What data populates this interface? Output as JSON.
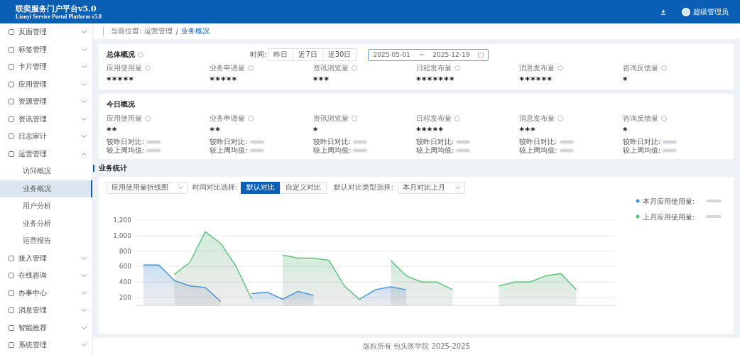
{
  "header": {
    "title": "联奕服务门户平台v5.0",
    "subtitle": "Lianyi Service Portal Platform v5.0",
    "user": "超级管理员"
  },
  "sidebar": {
    "items": [
      {
        "label": "页面管理",
        "expanded": false
      },
      {
        "label": "标签管理",
        "expanded": false
      },
      {
        "label": "卡片管理",
        "expanded": false
      },
      {
        "label": "应用管理",
        "expanded": false
      },
      {
        "label": "资源管理",
        "expanded": false
      },
      {
        "label": "资讯管理",
        "expanded": false
      },
      {
        "label": "日志审计",
        "expanded": false
      },
      {
        "label": "运营管理",
        "expanded": true,
        "children": [
          {
            "label": "访问概况",
            "selected": false
          },
          {
            "label": "业务概况",
            "selected": true
          },
          {
            "label": "用户分析",
            "selected": false
          },
          {
            "label": "业务分析",
            "selected": false
          },
          {
            "label": "运营报告",
            "selected": false
          }
        ]
      },
      {
        "label": "接入管理",
        "expanded": false
      },
      {
        "label": "在线咨询",
        "expanded": false
      },
      {
        "label": "办事中心",
        "expanded": false
      },
      {
        "label": "消息管理",
        "expanded": false
      },
      {
        "label": "智能推荐",
        "expanded": false
      },
      {
        "label": "系统管理",
        "expanded": false
      }
    ]
  },
  "breadcrumb": {
    "prefix": "当前位置:",
    "items": [
      "运营管理",
      "业务概况"
    ],
    "separator": "/"
  },
  "overall": {
    "title": "总体概况",
    "time_label": "时间:",
    "time_buttons": [
      {
        "label": "昨日",
        "selected": false
      },
      {
        "label": "近7日",
        "selected": false
      },
      {
        "label": "近30日",
        "selected": false
      }
    ],
    "date_start": "2025-05-01",
    "date_sep": "~",
    "date_end": "2025-12-19",
    "metrics": [
      {
        "label": "应用使用量",
        "value": "*****"
      },
      {
        "label": "业务申请量",
        "value": "*****"
      },
      {
        "label": "资讯浏览量",
        "value": "***"
      },
      {
        "label": "日程发布量",
        "value": "*******"
      },
      {
        "label": "消息发布量",
        "value": "******"
      },
      {
        "label": "咨询反馈量",
        "value": "*"
      }
    ]
  },
  "today": {
    "title": "今日概况",
    "metrics": [
      {
        "label": "应用使用量",
        "value": "**",
        "compare_day": "较昨日对比:",
        "compare_week": "较上周均值:"
      },
      {
        "label": "业务申请量",
        "value": "**",
        "compare_day": "较昨日对比:",
        "compare_week": "较上周均值:"
      },
      {
        "label": "资讯浏览量",
        "value": "*",
        "compare_day": "较昨日对比:",
        "compare_week": "较上周均值:"
      },
      {
        "label": "日程发布量",
        "value": "*****",
        "compare_day": "较昨日对比:",
        "compare_week": "较上周均值:"
      },
      {
        "label": "消息发布量",
        "value": "***",
        "compare_day": "较昨日对比:",
        "compare_week": "较上周均值:"
      },
      {
        "label": "咨询反馈量",
        "value": "*",
        "compare_day": "较昨日对比:",
        "compare_week": "较上周均值:"
      }
    ]
  },
  "stats": {
    "title": "业务统计",
    "chart_select": "应用使用量折线图",
    "compare_label": "时间对比选择:",
    "compare_buttons": [
      {
        "label": "默认对比",
        "selected": true
      },
      {
        "label": "自定义对比",
        "selected": false
      }
    ],
    "type_label": "默认对比类型选择:",
    "type_select": "本月对比上月",
    "chart_data": {
      "type": "area",
      "grid": true,
      "legend": "right",
      "ylim": [
        100,
        1200
      ],
      "yticks": [
        {
          "value": 200,
          "label": "200"
        },
        {
          "value": 400,
          "label": "400"
        },
        {
          "value": 600,
          "label": "600"
        },
        {
          "value": 800,
          "label": "800"
        },
        {
          "value": 1000,
          "label": "1,000"
        },
        {
          "value": 1200,
          "label": "1,200"
        }
      ],
      "categories": [
        null,
        null,
        null,
        null,
        null,
        null,
        null,
        null,
        null,
        null,
        null,
        null,
        null,
        null,
        null,
        null,
        null,
        null,
        null,
        null,
        null,
        null,
        null,
        null,
        null,
        null,
        null,
        null,
        null,
        null,
        null
      ],
      "series": [
        {
          "name": "本月应用使用量:",
          "color": "#3d8fe0",
          "values": [
            620,
            620,
            420,
            350,
            330,
            150,
            null,
            250,
            270,
            180,
            280,
            230,
            null,
            null,
            180,
            300,
            340,
            300,
            null,
            null,
            null,
            null,
            null,
            null,
            null,
            null,
            null,
            null,
            null,
            null,
            null
          ]
        },
        {
          "name": "上月应用使用量:",
          "color": "#5bbf7a",
          "values": [
            null,
            null,
            500,
            650,
            1050,
            900,
            600,
            180,
            null,
            750,
            710,
            710,
            680,
            350,
            170,
            null,
            680,
            480,
            400,
            400,
            300,
            null,
            null,
            350,
            400,
            400,
            480,
            510,
            300,
            null,
            null
          ]
        }
      ]
    }
  },
  "footer": "版权所有 包头医学院 2025-2025"
}
